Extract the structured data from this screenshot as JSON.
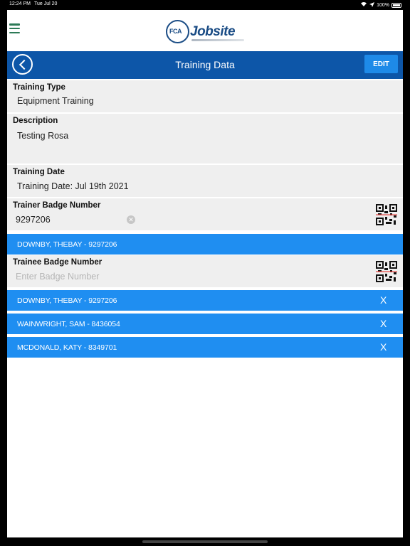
{
  "status": {
    "time": "12:24 PM",
    "date": "Tue Jul 20",
    "battery": "100%"
  },
  "header": {
    "logo_fca": "FCA",
    "logo_text": "Jobsite"
  },
  "nav": {
    "title": "Training Data",
    "edit_label": "EDIT"
  },
  "fields": {
    "training_type": {
      "label": "Training Type",
      "value": "Equipment Training"
    },
    "description": {
      "label": "Description",
      "value": "Testing Rosa"
    },
    "training_date": {
      "label": "Training Date",
      "value": "Training Date: Jul 19th 2021"
    },
    "trainer_badge": {
      "label": "Trainer Badge Number",
      "value": "9297206"
    },
    "trainee_badge": {
      "label": "Trainee Badge Number",
      "placeholder": "Enter Badge Number"
    }
  },
  "trainer": {
    "name": "DOWNBY, THEBAY - 9297206"
  },
  "trainees": [
    {
      "name": "DOWNBY, THEBAY - 9297206",
      "remove": "X"
    },
    {
      "name": "WAINWRIGHT, SAM - 8436054",
      "remove": "X"
    },
    {
      "name": "MCDONALD, KATY - 8349701",
      "remove": "X"
    }
  ],
  "colors": {
    "nav": "#0d56a8",
    "row": "#1f8ef1",
    "edit": "#1e8ae8",
    "menu": "#2d7a57",
    "logo": "#1a4c85"
  }
}
